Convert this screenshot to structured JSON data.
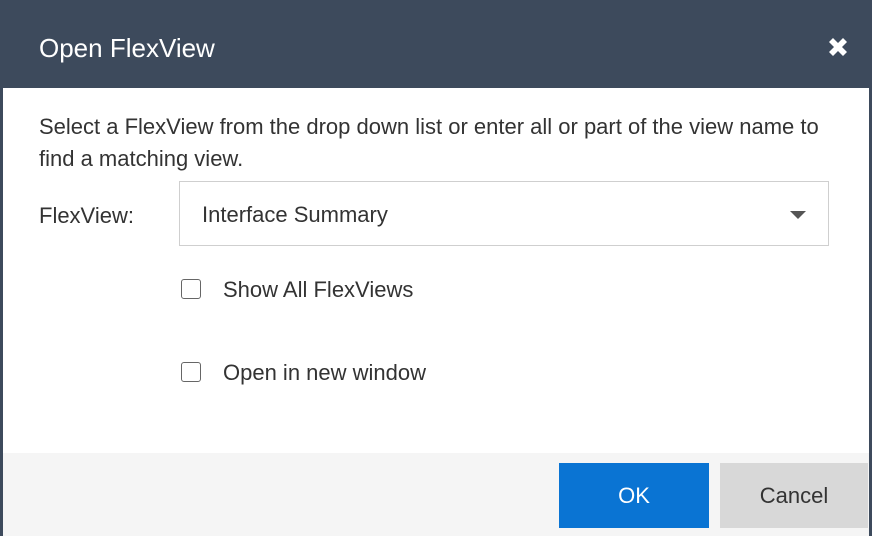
{
  "dialog": {
    "title": "Open FlexView",
    "close_icon": "close-icon",
    "description": "Select a FlexView from the drop down list or enter all or part of the view name to find a matching view.",
    "flexview_label": "FlexView:",
    "flexview_value": "Interface Summary",
    "show_all_label": "Show All FlexViews",
    "show_all_checked": false,
    "new_window_label": "Open in new window",
    "new_window_checked": false,
    "ok_label": "OK",
    "cancel_label": "Cancel"
  },
  "colors": {
    "titlebar": "#3d4a5c",
    "ok_button": "#0a74d3",
    "cancel_button": "#d8d8d8",
    "footer": "#f5f5f5"
  }
}
